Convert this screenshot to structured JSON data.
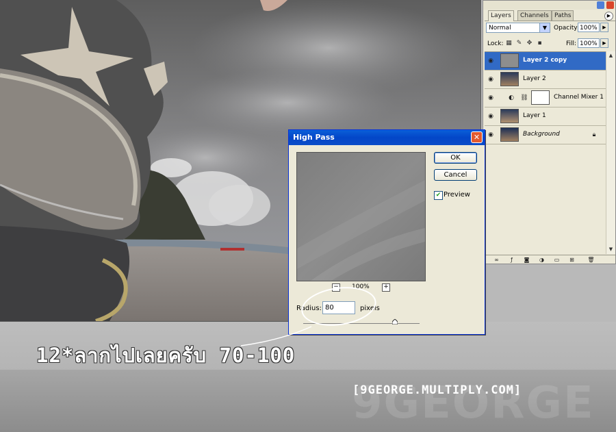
{
  "palette": {
    "tabs": [
      "Layers",
      "Channels",
      "Paths"
    ],
    "blend_mode": "Normal",
    "opacity_label": "Opacity:",
    "opacity_value": "100%",
    "lock_label": "Lock:",
    "fill_label": "Fill:",
    "fill_value": "100%",
    "layers": [
      {
        "name": "Layer 2 copy",
        "selected": true
      },
      {
        "name": "Layer 2",
        "selected": false
      },
      {
        "name": "Channel Mixer 1",
        "selected": false
      },
      {
        "name": "Layer 1",
        "selected": false
      },
      {
        "name": "Background",
        "selected": false
      }
    ]
  },
  "dialog": {
    "title": "High Pass",
    "ok_label": "OK",
    "cancel_label": "Cancel",
    "preview_label": "Preview",
    "zoom": "100%",
    "radius_label": "Radius:",
    "radius_value": "80",
    "unit": "pixels"
  },
  "caption": "12*ลากไปเลยครับ 70-100",
  "watermark": {
    "title": "[9GEORGE.MULTIPLY.COM]",
    "big": "9GEORGE"
  },
  "colors": {
    "selection": "#316ac5",
    "titlebar": "#0346c8",
    "panel": "#ece9d8"
  }
}
